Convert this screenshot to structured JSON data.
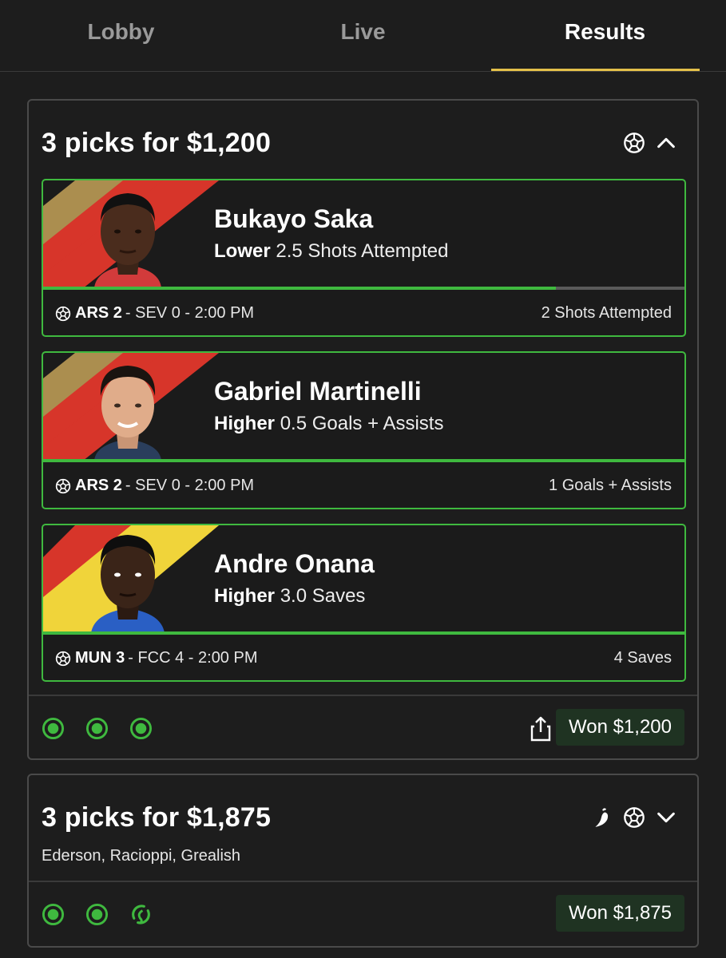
{
  "tabs": [
    {
      "label": "Lobby",
      "active": false
    },
    {
      "label": "Live",
      "active": false
    },
    {
      "label": "Results",
      "active": true
    }
  ],
  "entries": [
    {
      "title": "3 picks for $1,200",
      "icons": [
        "soccer-ball-icon",
        "chevron-up-icon"
      ],
      "picks": [
        {
          "name": "Bukayo Saka",
          "direction": "Lower",
          "line": "2.5 Shots Attempted",
          "team": "ARS 2",
          "match_rest": " - SEV 0 - 2:00 PM",
          "result": "2 Shots Attempted",
          "progress": 0.8,
          "stripe_colors": [
            "#ab8e4f",
            "#d7352a"
          ]
        },
        {
          "name": "Gabriel Martinelli",
          "direction": "Higher",
          "line": "0.5 Goals + Assists",
          "team": "ARS 2",
          "match_rest": " - SEV 0 - 2:00 PM",
          "result": "1 Goals + Assists",
          "progress": 1.0,
          "stripe_colors": [
            "#ab8e4f",
            "#d7352a"
          ]
        },
        {
          "name": "Andre Onana",
          "direction": "Higher",
          "line": "3.0 Saves",
          "team": "MUN 3",
          "match_rest": " - FCC 4 - 2:00 PM",
          "result": "4 Saves",
          "progress": 1.0,
          "stripe_colors": [
            "#d7352a",
            "#f0d43a"
          ]
        }
      ],
      "status": "Won $1,200",
      "pick_status_icons": [
        "check-circle-icon",
        "check-circle-icon",
        "check-circle-icon"
      ]
    },
    {
      "title": "3 picks for $1,875",
      "icons": [
        "chili-pepper-icon",
        "soccer-ball-icon",
        "chevron-down-icon"
      ],
      "players": "Ederson, Racioppi, Grealish",
      "status": "Won $1,875",
      "pick_status_icons": [
        "check-circle-icon",
        "check-circle-icon",
        "swap-circle-icon"
      ]
    }
  ],
  "colors": {
    "background": "#1d1d1d",
    "accent_green": "#3fb93f",
    "tab_underline": "#e3c04a",
    "won_badge_bg": "#1f3322"
  }
}
